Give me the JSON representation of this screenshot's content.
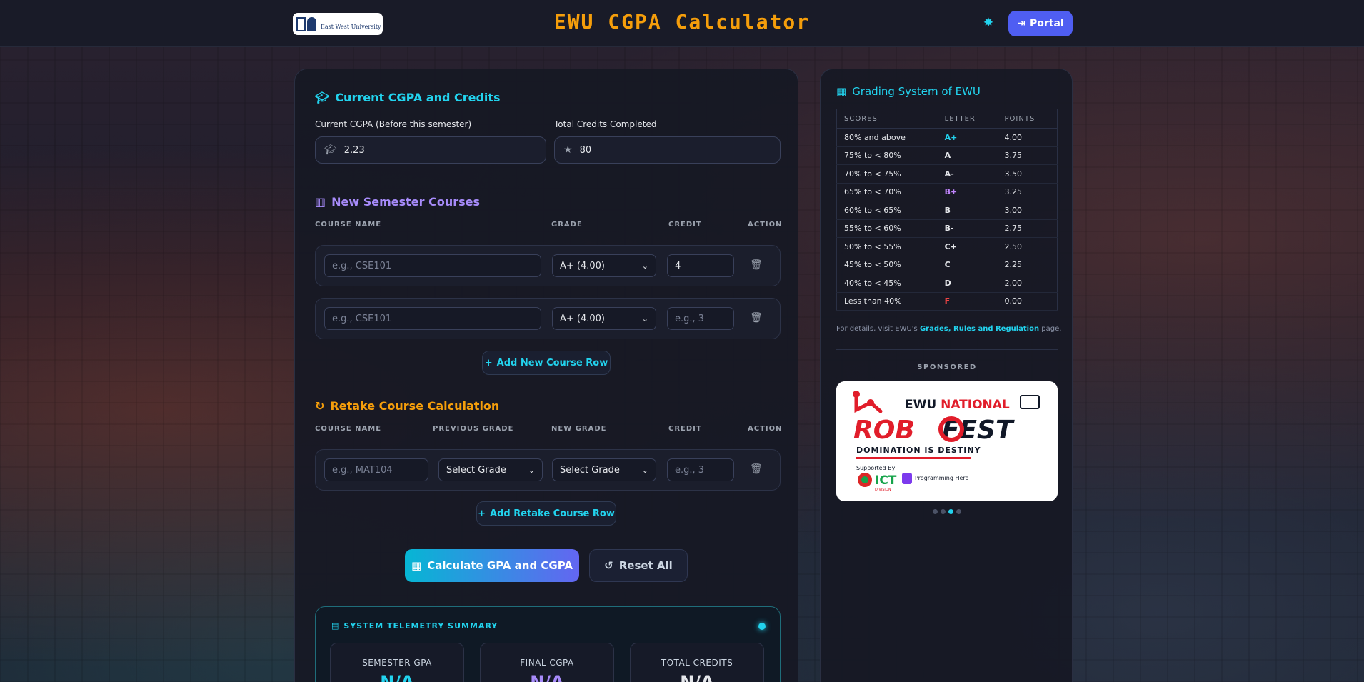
{
  "header": {
    "logo_text": "East West University",
    "title": "EWU CGPA Calculator",
    "portal_label": "Portal"
  },
  "current": {
    "section_title": "Current CGPA and Credits",
    "cgpa_label": "Current CGPA (Before this semester)",
    "cgpa_value": "2.23",
    "credits_label": "Total Credits Completed",
    "credits_value": "80"
  },
  "new_courses": {
    "section_title": "New Semester Courses",
    "columns": [
      "COURSE NAME",
      "GRADE",
      "CREDIT",
      "ACTION"
    ],
    "rows": [
      {
        "course_placeholder": "e.g., CSE101",
        "grade": "A+ (4.00)",
        "credit": "4",
        "credit_placeholder": "e.g., 3"
      },
      {
        "course_placeholder": "e.g., CSE101",
        "grade": "A+ (4.00)",
        "credit": "",
        "credit_placeholder": "e.g., 3"
      }
    ],
    "add_label": "Add New Course Row"
  },
  "retake": {
    "section_title": "Retake Course Calculation",
    "columns": [
      "COURSE NAME",
      "PREVIOUS GRADE",
      "NEW GRADE",
      "CREDIT",
      "ACTION"
    ],
    "rows": [
      {
        "course_placeholder": "e.g., MAT104",
        "previous_grade": "Select Grade",
        "new_grade": "Select Grade",
        "credit_placeholder": "e.g., 3"
      }
    ],
    "add_label": "Add Retake Course Row"
  },
  "actions": {
    "calculate_label": "Calculate GPA and CGPA",
    "reset_label": "Reset All"
  },
  "telemetry": {
    "title": "SYSTEM TELEMETRY SUMMARY",
    "stats": [
      {
        "label": "SEMESTER GPA",
        "value": "N/A",
        "color": "#22d3ee"
      },
      {
        "label": "FINAL CGPA",
        "value": "N/A",
        "color": "#a78bfa"
      },
      {
        "label": "TOTAL CREDITS",
        "value": "N/A",
        "color": "#e5e7eb"
      }
    ]
  },
  "grading": {
    "title": "Grading System of EWU",
    "columns": [
      "SCORES",
      "LETTER",
      "POINTS"
    ],
    "rows": [
      {
        "score": "80% and above",
        "letter": "A+",
        "points": "4.00",
        "color": "#22d3ee"
      },
      {
        "score": "75% to < 80%",
        "letter": "A",
        "points": "3.75",
        "color": "#e5e7eb"
      },
      {
        "score": "70% to < 75%",
        "letter": "A-",
        "points": "3.50",
        "color": "#e5e7eb"
      },
      {
        "score": "65% to < 70%",
        "letter": "B+",
        "points": "3.25",
        "color": "#c084fc"
      },
      {
        "score": "60% to < 65%",
        "letter": "B",
        "points": "3.00",
        "color": "#e5e7eb"
      },
      {
        "score": "55% to < 60%",
        "letter": "B-",
        "points": "2.75",
        "color": "#e5e7eb"
      },
      {
        "score": "50% to < 55%",
        "letter": "C+",
        "points": "2.50",
        "color": "#e5e7eb"
      },
      {
        "score": "45% to < 50%",
        "letter": "C",
        "points": "2.25",
        "color": "#e5e7eb"
      },
      {
        "score": "40% to < 45%",
        "letter": "D",
        "points": "2.00",
        "color": "#e5e7eb"
      },
      {
        "score": "Less than 40%",
        "letter": "F",
        "points": "0.00",
        "color": "#ef4444"
      }
    ],
    "details_prefix": "For details, visit EWU's ",
    "details_link": "Grades, Rules and Regulation",
    "details_suffix": " page."
  },
  "sponsored": {
    "label": "SPONSORED",
    "ad_line1_a": "EWU ",
    "ad_line1_b": "NATIONAL",
    "ad_line2_a": "ROB",
    "ad_line2_b": "FEST",
    "ad_tagline": "DOMINATION IS DESTINY",
    "ad_supported": "Supported By",
    "ad_ict": "ICT",
    "ad_ict_sub": "DIVISION",
    "ad_ph": "Programming Hero",
    "slides": 4,
    "active_slide": 2
  }
}
